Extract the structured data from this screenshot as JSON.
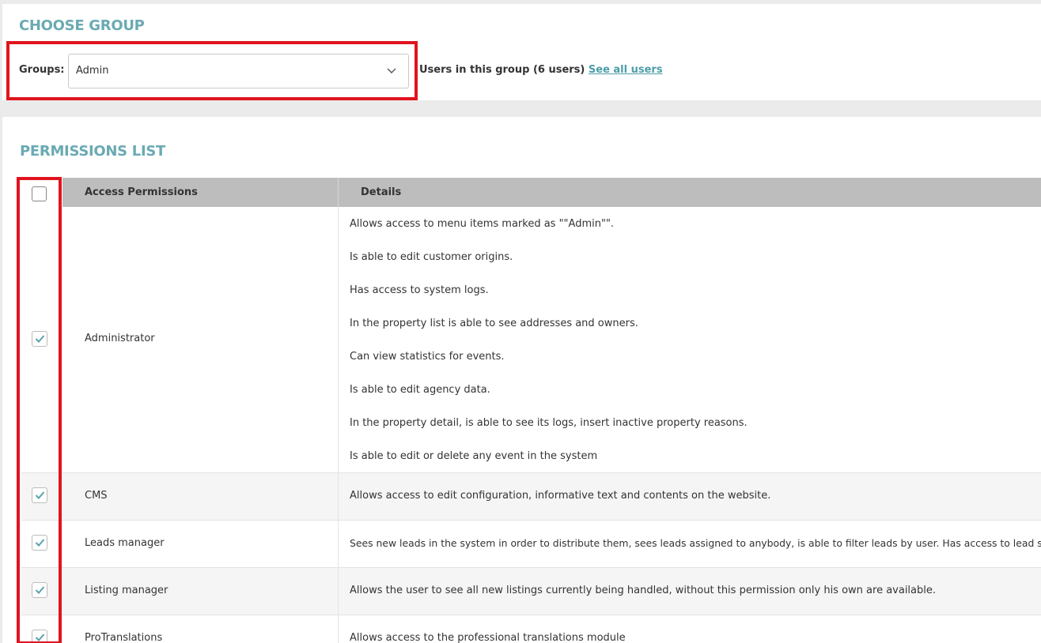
{
  "choose_group": {
    "title": "CHOOSE GROUP",
    "groups_label": "Groups:",
    "selected_group": "Admin",
    "users_info": "Users in this group (6 users)",
    "see_all_link": "See all users"
  },
  "permissions": {
    "title": "PERMISSIONS LIST",
    "header_col1": "Access Permissions",
    "header_col2": "Details",
    "rows": [
      {
        "name": "Administrator",
        "checked": true,
        "details": [
          "Allows access to menu items marked as \"\"Admin\"\".",
          "Is able to edit customer origins.",
          "Has access to system logs.",
          "In the property list is able to see addresses and owners.",
          "Can view statistics for events.",
          "Is able to edit agency data.",
          "In the property detail, is able to see its logs, insert inactive property reasons.",
          "Is able to edit or delete any event in the system"
        ]
      },
      {
        "name": "CMS",
        "checked": true,
        "details": [
          "Allows access to edit configuration, informative text and contents on the website."
        ]
      },
      {
        "name": "Leads manager",
        "checked": true,
        "details": [
          "Sees new leads in the system in order to distribute them, sees leads assigned to anybody, is able to filter leads by user. Has access to lead screen."
        ]
      },
      {
        "name": "Listing manager",
        "checked": true,
        "details": [
          "Allows the user to see all new listings currently being handled, without this permission only his own are available."
        ]
      },
      {
        "name": "ProTranslations",
        "checked": true,
        "details": [
          "Allows access to the professional translations module"
        ]
      }
    ]
  },
  "colors": {
    "accent": "#6aaab3",
    "link": "#4d9ea8",
    "highlight": "#e0141e",
    "header_bg": "#bdbdbd"
  }
}
